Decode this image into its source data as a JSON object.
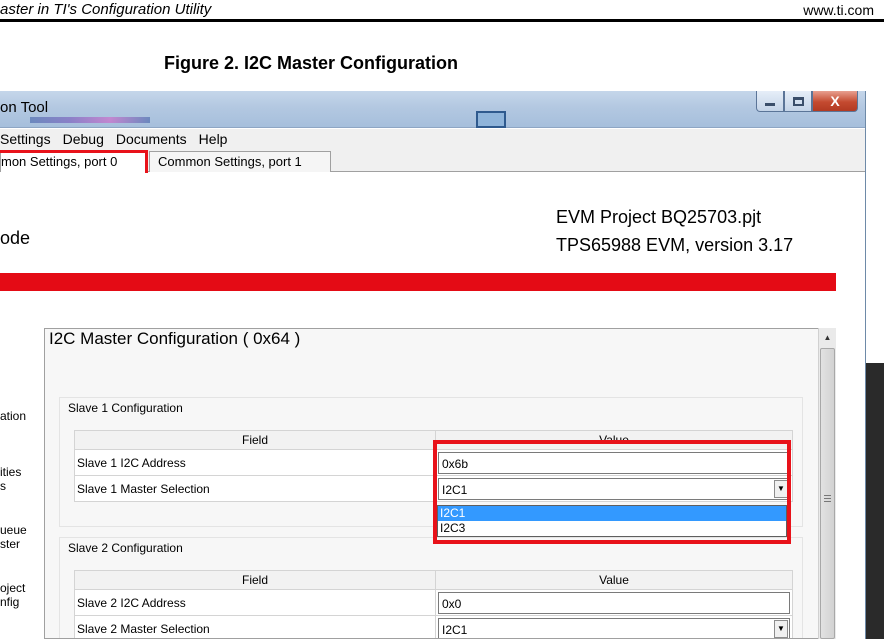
{
  "doc_header": {
    "left": "aster in TI's Configuration Utility",
    "right": "www.ti.com"
  },
  "figure_caption": "Figure 2. I2C Master Configuration",
  "window": {
    "title": "on Tool",
    "controls": {
      "close": "X"
    }
  },
  "menu": [
    "Settings",
    "Debug",
    "Documents",
    "Help"
  ],
  "tabs": [
    {
      "label": "mon Settings, port 0",
      "active": true
    },
    {
      "label": "Common Settings, port 1",
      "active": false
    }
  ],
  "header": {
    "mode": "ode",
    "project_file": "EVM Project BQ25703.pjt",
    "device": "TPS65988 EVM, version 3.17"
  },
  "left_nav": [
    {
      "lines": [
        "ation"
      ]
    },
    {
      "lines": [
        "ities",
        "s"
      ]
    },
    {
      "lines": [
        "ueue",
        "ster"
      ]
    },
    {
      "lines": [
        "oject",
        "nfig"
      ]
    }
  ],
  "panel": {
    "title": "I2C Master Configuration  ( 0x64 )",
    "groups": [
      {
        "label": "Slave 1 Configuration",
        "headers": {
          "field": "Field",
          "value": "Value"
        },
        "rows": [
          {
            "field": "Slave 1 I2C Address",
            "value": "0x6b",
            "type": "text"
          },
          {
            "field": "Slave 1 Master Selection",
            "value": "I2C1",
            "type": "select"
          }
        ]
      },
      {
        "label": "Slave 2 Configuration",
        "headers": {
          "field": "Field",
          "value": "Value"
        },
        "rows": [
          {
            "field": "Slave 2 I2C Address",
            "value": "0x0",
            "type": "text"
          },
          {
            "field": "Slave 2 Master Selection",
            "value": "I2C1",
            "type": "select"
          }
        ]
      }
    ],
    "dropdown_options": [
      {
        "label": "I2C1",
        "selected": true
      },
      {
        "label": "I2C3",
        "selected": false
      }
    ]
  },
  "colors": {
    "highlight": "#e8121a",
    "red_band": "#e40b15",
    "selection": "#3399ff"
  }
}
